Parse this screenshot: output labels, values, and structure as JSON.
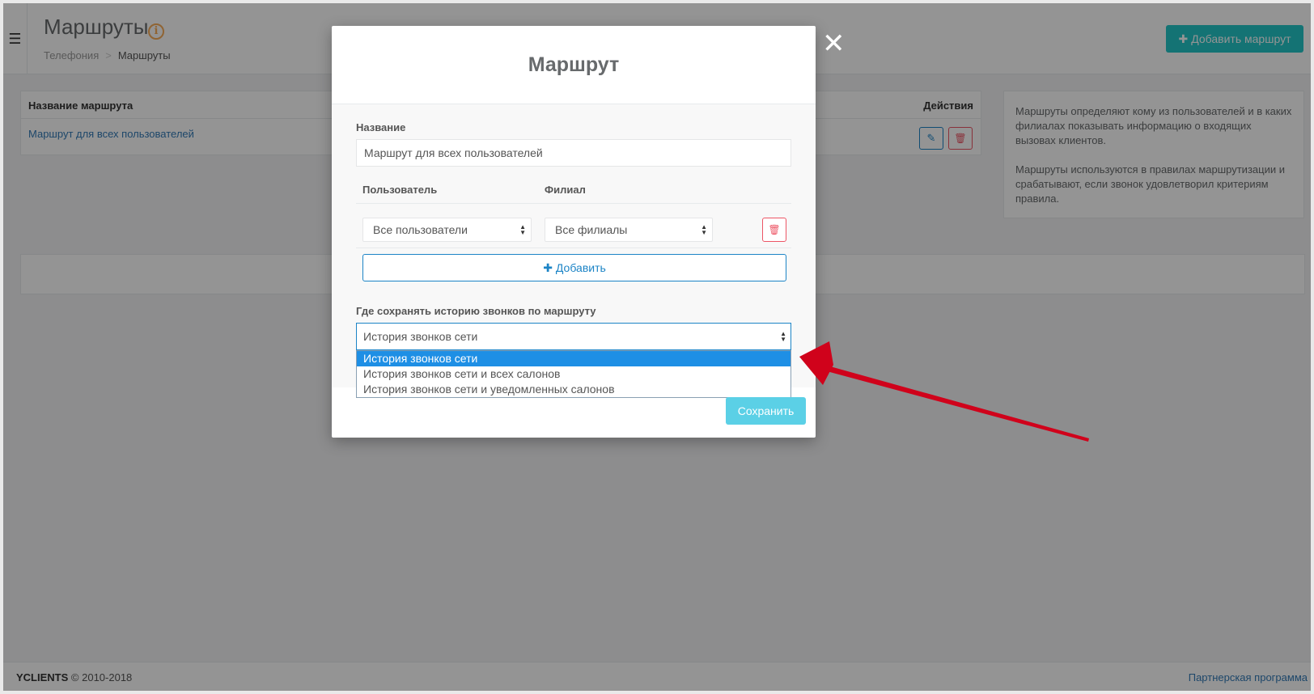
{
  "header": {
    "title": "Маршруты",
    "breadcrumb": {
      "root": "Телефония",
      "separator": ">",
      "current": "Маршруты"
    },
    "add_route_label": "Добавить маршрут"
  },
  "routes_table": {
    "col_name": "Название маршрута",
    "col_actions": "Действия",
    "rows": [
      {
        "name": "Маршрут для всех пользователей"
      }
    ]
  },
  "info_panel": {
    "p1": "Маршруты определяют кому из пользователей и в каких филиалах показывать информацию о входящих вызовах клиентов.",
    "p2": "Маршруты используются в правилах маршрутизации и срабатывают, если звонок удовлетворил критериям правила."
  },
  "footer": {
    "brand": "YCLIENTS",
    "copyright": "© 2010-2018",
    "partner_link": "Партнерская программа"
  },
  "modal": {
    "title": "Маршрут",
    "name_label": "Название",
    "name_value": "Маршрут для всех пользователей",
    "user_col": "Пользователь",
    "branch_col": "Филиал",
    "user_value": "Все пользователи",
    "branch_value": "Все филиалы",
    "add_label": "Добавить",
    "history_label": "Где сохранять историю звонков по маршруту",
    "history_value": "История звонков сети",
    "history_options": [
      "История звонков сети",
      "История звонков сети и всех салонов",
      "История звонков сети и уведомленных салонов"
    ],
    "save_label": "Сохранить"
  },
  "colors": {
    "accent_teal": "#23c6c8",
    "accent_blue": "#1c84c6",
    "danger": "#ed5565",
    "highlight": "#1e8fe5",
    "annotation_arrow": "#d0021b"
  }
}
